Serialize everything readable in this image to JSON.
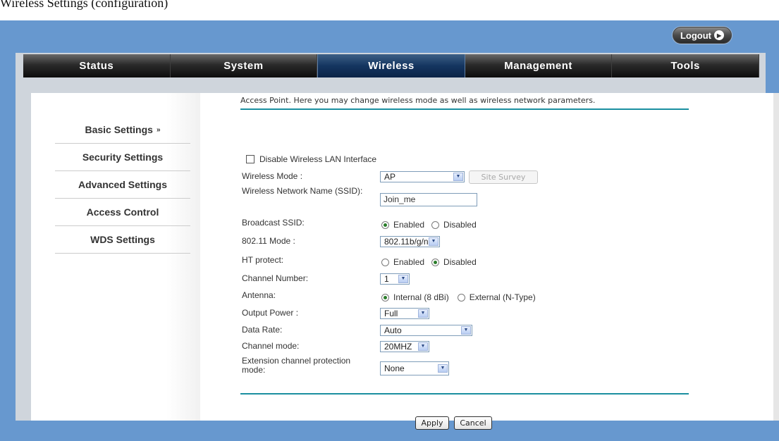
{
  "caption": {
    "text": "Wireless Settings (configuration)"
  },
  "header": {
    "logout_label": "Logout"
  },
  "nav": {
    "tabs": [
      {
        "label": "Status"
      },
      {
        "label": "System"
      },
      {
        "label": "Wireless",
        "active": true
      },
      {
        "label": "Management"
      },
      {
        "label": "Tools"
      }
    ]
  },
  "sidebar": {
    "items": [
      {
        "label": "Basic Settings",
        "active": true
      },
      {
        "label": "Security Settings"
      },
      {
        "label": "Advanced Settings"
      },
      {
        "label": "Access Control"
      },
      {
        "label": "WDS Settings"
      }
    ]
  },
  "main": {
    "intro_text": "Access Point. Here you may change wireless mode as well as wireless network parameters.",
    "disable_wlan_label": "Disable Wireless LAN Interface",
    "disable_wlan_checked": false,
    "fields": {
      "wireless_mode": {
        "label": "Wireless Mode :",
        "value": "AP"
      },
      "site_survey_label": "Site Survey",
      "ssid": {
        "label": "Wireless Network Name (SSID):",
        "value": "Join_me"
      },
      "broadcast_ssid": {
        "label": "Broadcast SSID:",
        "options": [
          "Enabled",
          "Disabled"
        ],
        "selected": "Enabled"
      },
      "mode_80211": {
        "label": "802.11 Mode :",
        "value": "802.11b/g/n"
      },
      "ht_protect": {
        "label": "HT protect:",
        "options": [
          "Enabled",
          "Disabled"
        ],
        "selected": "Disabled"
      },
      "channel_number": {
        "label": "Channel Number:",
        "value": "1"
      },
      "antenna": {
        "label": "Antenna:",
        "options": [
          "Internal (8 dBi)",
          "External (N-Type)"
        ],
        "selected": "Internal (8 dBi)"
      },
      "output_power": {
        "label": "Output Power :",
        "value": "Full"
      },
      "data_rate": {
        "label": "Data Rate:",
        "value": "Auto"
      },
      "channel_mode": {
        "label": "Channel mode:",
        "value": "20MHZ"
      },
      "ext_channel_protection": {
        "label": "Extension channel protection mode:",
        "value": "None"
      }
    },
    "apply_label": "Apply",
    "cancel_label": "Cancel"
  },
  "colors": {
    "frame_blue": "#6798cf",
    "accent_teal": "#1a8fa0",
    "nav_active": "#143560"
  }
}
